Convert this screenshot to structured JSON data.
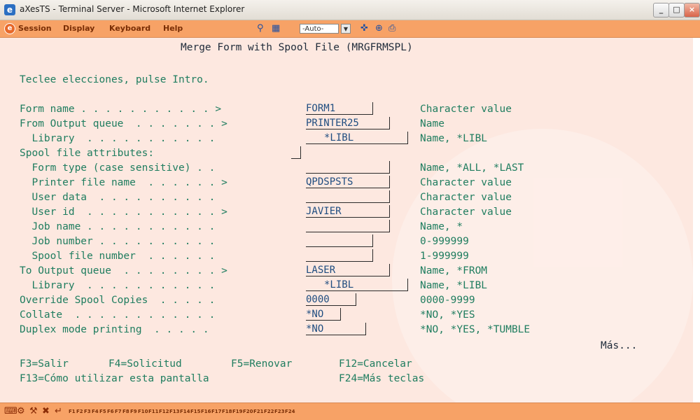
{
  "window": {
    "title": "aXesTS - Terminal Server - Microsoft Internet Explorer",
    "app_icon": "e",
    "min": "_",
    "max": "□",
    "close": "×"
  },
  "toolbar": {
    "session_icon": "e",
    "menu": [
      "Session",
      "Display",
      "Keyboard",
      "Help"
    ],
    "icons": [
      "find-icon",
      "grid-icon",
      "refresh-icon",
      "zoom-icon",
      "print-icon"
    ],
    "icon_glyphs": [
      "⚲",
      "▦",
      "✜",
      "⊕",
      "⎙"
    ],
    "font_select": "-Auto-"
  },
  "screen": {
    "title": "Merge Form with Spool File (MRGFRMSPL)",
    "instruction": "Teclee elecciones, pulse Intro.",
    "rows": [
      {
        "label": "Form name . . . . . . . . . . . >",
        "value": "FORM1",
        "hint": "Character value"
      },
      {
        "label": "From Output queue  . . . . . . . >",
        "value": "PRINTER25",
        "hint": "Name"
      },
      {
        "label": "  Library  . . . . . . . . . . .",
        "value": "*LIBL",
        "hint": "Name, *LIBL"
      },
      {
        "label": "Spool file attributes:",
        "value": "",
        "hint": ""
      },
      {
        "label": "  Form type (case sensitive) . .",
        "value": "",
        "hint": "Name, *ALL, *LAST"
      },
      {
        "label": "  Printer file name  . . . . . . >",
        "value": "QPDSPSTS",
        "hint": "Character value"
      },
      {
        "label": "  User data  . . . . . . . . . .",
        "value": "",
        "hint": "Character value"
      },
      {
        "label": "  User id  . . . . . . . . . . . >",
        "value": "JAVIER",
        "hint": "Character value"
      },
      {
        "label": "  Job name . . . . . . . . . . .",
        "value": "",
        "hint": "Name, *"
      },
      {
        "label": "  Job number . . . . . . . . . .",
        "value": "",
        "hint": "0-999999"
      },
      {
        "label": "  Spool file number  . . . . . .",
        "value": "",
        "hint": "1-999999"
      },
      {
        "label": "To Output queue  . . . . . . . . >",
        "value": "LASER",
        "hint": "Name, *FROM"
      },
      {
        "label": "  Library  . . . . . . . . . . .",
        "value": "*LIBL",
        "hint": "Name, *LIBL"
      },
      {
        "label": "Override Spool Copies  . . . . .",
        "value": "0000",
        "hint": "0000-9999"
      },
      {
        "label": "Collate  . . . . . . . . . . . .",
        "value": "*NO",
        "hint": "*NO, *YES"
      },
      {
        "label": "Duplex mode printing  . . . . .",
        "value": "*NO",
        "hint": "*NO, *YES, *TUMBLE"
      }
    ],
    "more": "Más...",
    "fkeys_line1": [
      "F3=Salir",
      "F4=Solicitud",
      "F5=Renovar",
      "F12=Cancelar"
    ],
    "fkeys_line2": [
      "F13=Cómo utilizar esta pantalla",
      "F24=Más teclas"
    ]
  },
  "statusbar": {
    "icons": [
      "keyboard-icon",
      "settings-icon",
      "tools-icon",
      "close-session-icon",
      "enter-icon"
    ],
    "icon_glyphs": [
      "⌨",
      "⚙",
      "⚒",
      "✖",
      "↵"
    ],
    "fkeys": [
      "F1",
      "F2",
      "F3",
      "F4",
      "F5",
      "F6",
      "F7",
      "F8",
      "F9",
      "F10",
      "F11",
      "F12",
      "F13",
      "F14",
      "F15",
      "F16",
      "F17",
      "F18",
      "F19",
      "F20",
      "F21",
      "F22",
      "F23",
      "F24"
    ]
  }
}
